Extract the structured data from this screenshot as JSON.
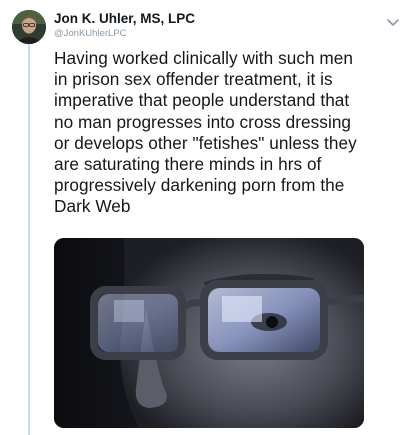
{
  "tweet": {
    "display_name": "Jon K. Uhler, MS, LPC",
    "handle": "@JonKUhlerLPC",
    "text": "Having worked clinically with such men\nin prison sex offender treatment, it is\nimperative that people understand that\nno man progresses into cross dressing\nor develops other \"fetishes\" unless they\nare saturating there minds in hrs of\nprogressively darkening porn from the\nDark Web",
    "more_icon": "chevron-down-icon"
  },
  "colors": {
    "text": "#14171a",
    "secondary": "#8a9aa8",
    "thread_line": "#c4dff5"
  }
}
